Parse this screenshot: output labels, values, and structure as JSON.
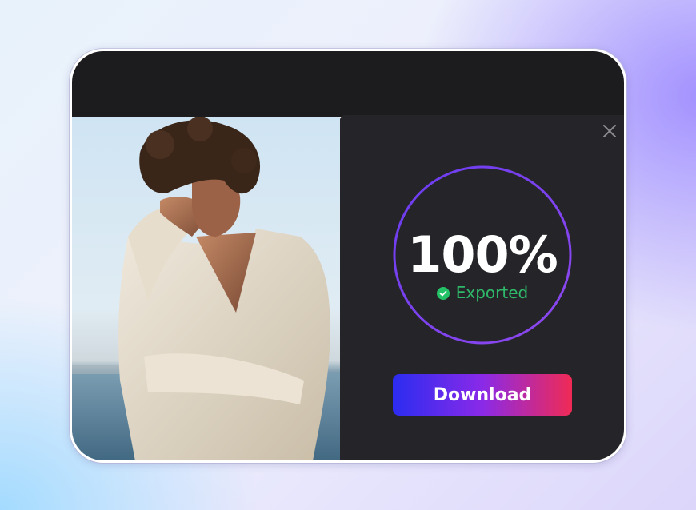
{
  "export_dialog": {
    "progress_percent": 100,
    "progress_text": "100%",
    "status_text": "Exported",
    "download_label": "Download",
    "close_icon": "close-icon",
    "status_icon": "check-circle-icon"
  },
  "preview": {
    "image": "photo-man-by-sea"
  },
  "colors": {
    "titlebar": "#1c1c1f",
    "panel": "#252529",
    "ring": "#7b44f0",
    "status": "#2fb86a",
    "button_gradient": [
      "#2b2cf0",
      "#8a2ae8",
      "#f02a55"
    ]
  }
}
